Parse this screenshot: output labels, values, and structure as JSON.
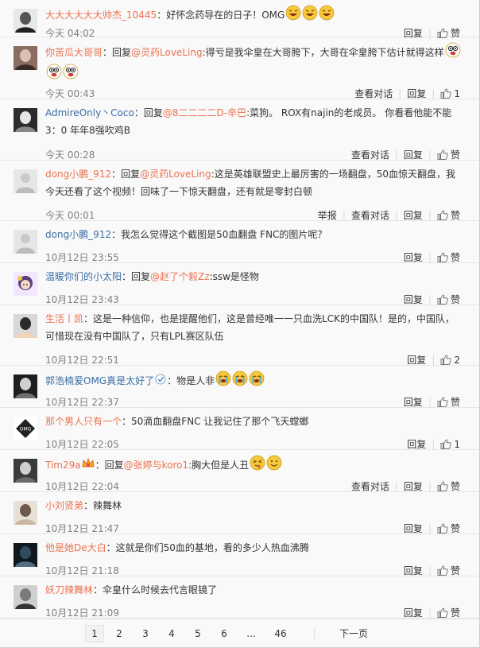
{
  "labels": {
    "reply": "回复",
    "like": "赞",
    "view_thread": "查看对话",
    "report": "举报"
  },
  "comments": [
    {
      "user": "大大大大大大帅杰_10445",
      "text": "：好怀念药导在的日子！OMG",
      "emojis": [
        "haha-emoji",
        "haha-emoji",
        "haha-emoji"
      ],
      "time": "今天 04:02",
      "like_count": ""
    },
    {
      "user": "你苦瓜大哥哥",
      "reply_prefix": "：回复",
      "mention": "@灵药LoveLing",
      "text": ":得亏是我伞皇在大哥胯下，大哥在伞皇胯下估计就得这样",
      "emojis": [
        "crazy-emoji",
        "crazy-emoji",
        "crazy-emoji"
      ],
      "time": "今天 00:43",
      "like_count": "1"
    },
    {
      "user": "AdmireOnly丶Coco",
      "reply_prefix": "：回复",
      "mention": "@8二二二二D-辛巴",
      "text": ":菜狗。 ROX有najin的老成员。 你看看他能不能3：0  年年8强吹鸡B",
      "time": "今天 00:28",
      "like_count": ""
    },
    {
      "user": "dong小鹏_912",
      "reply_prefix": "：回复",
      "mention": "@灵药LoveLing",
      "text": ":这是英雄联盟史上最厉害的一场翻盘，50血惊天翻盘，我今天还看了这个视频！回味了一下惊天翻盘，还有就是零封白顿",
      "time": "今天 00:01",
      "like_count": ""
    },
    {
      "user": "dong小鹏_912",
      "text": "：我怎么觉得这个截图是50血翻盘 FNC的图片呢？",
      "time": "10月12日 23:55",
      "like_count": ""
    },
    {
      "user": "温暖你们的小太阳",
      "reply_prefix": "：回复",
      "mention": "@赵了个毅Zz",
      "text": ":ssw是怪物",
      "time": "10月12日 23:43",
      "like_count": ""
    },
    {
      "user": "生活丨凯",
      "text": "：这是一种信仰，也是提醒他们，这是曾经唯一一只血洗LCK的中国队！是的，中国队，可惜现在没有中国队了，只有LPL赛区队伍",
      "time": "10月12日 22:51",
      "like_count": "2"
    },
    {
      "user": "郭浩楠爱OMG真是太好了",
      "text": "：物是人非",
      "emojis": [
        "cry-emoji",
        "cry-emoji",
        "cry-emoji"
      ],
      "time": "10月12日 22:37",
      "like_count": ""
    },
    {
      "user": "那个男人只有一个",
      "text": "：50滴血翻盘FNC 让我记住了那个飞天螳螂",
      "time": "10月12日 22:05",
      "like_count": "1"
    },
    {
      "user": "Tim29a",
      "reply_prefix": "：回复",
      "mention": "@张婷与koro1",
      "text": ":胸大但是人丑",
      "emojis": [
        "naughty-emoji",
        "smile-emoji"
      ],
      "time": "10月12日 22:04",
      "like_count": ""
    },
    {
      "user": "小刘贤弟",
      "text": "：辣舞林",
      "time": "10月12日 21:47",
      "like_count": ""
    },
    {
      "user": "他是她De大白",
      "text": "：这就是你们50血的基地，看的多少人热血沸腾",
      "time": "10月12日 21:18",
      "like_count": ""
    },
    {
      "user": "妖刀辣舞林",
      "text": "：伞皇什么时候去代言眼镜了",
      "time": "10月12日 21:09",
      "like_count": ""
    }
  ],
  "pagination": {
    "pages": [
      "1",
      "2",
      "3",
      "4",
      "5",
      "6",
      "...",
      "46"
    ],
    "current": "1",
    "next_label": "下一页"
  },
  "colors": {
    "username": "#eb7350",
    "username_blue": "#3b6ea5",
    "meta": "#808080",
    "divider": "#e6e6e6"
  }
}
